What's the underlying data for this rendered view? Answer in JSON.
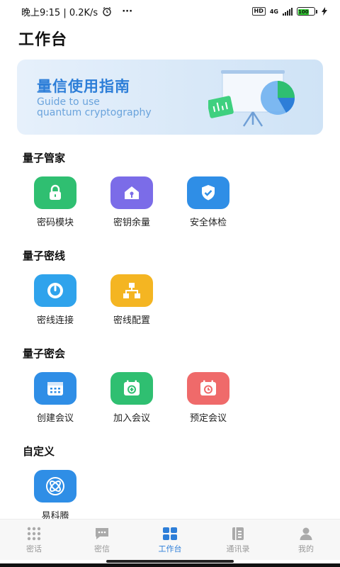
{
  "status_bar": {
    "time": "晚上9:15 | 0.2K/s",
    "more": "···",
    "network": "4G",
    "hd": "HD",
    "battery": "100"
  },
  "header": {
    "title": "工作台"
  },
  "banner": {
    "title": "量信使用指南",
    "subtitle": "Guide to use\nquantum cryptography"
  },
  "sections": [
    {
      "title": "量子管家",
      "items": [
        {
          "label": "密码模块",
          "icon": "lock-icon",
          "color": "#2fbf71"
        },
        {
          "label": "密钥余量",
          "icon": "key-house-icon",
          "color": "#7b6ce8"
        },
        {
          "label": "安全体检",
          "icon": "shield-check-icon",
          "color": "#2f8ee6"
        }
      ]
    },
    {
      "title": "量子密线",
      "items": [
        {
          "label": "密线连接",
          "icon": "connect-icon",
          "color": "#2fa3ec"
        },
        {
          "label": "密线配置",
          "icon": "network-icon",
          "color": "#f4b522"
        }
      ]
    },
    {
      "title": "量子密会",
      "items": [
        {
          "label": "创建会议",
          "icon": "calendar-icon",
          "color": "#2f8ee6"
        },
        {
          "label": "加入会议",
          "icon": "calendar-add-icon",
          "color": "#2fbf71"
        },
        {
          "label": "预定会议",
          "icon": "calendar-clock-icon",
          "color": "#ef6a6a"
        }
      ]
    },
    {
      "title": "自定义",
      "items": [
        {
          "label": "易科腾",
          "icon": "atom-icon",
          "color": "#2f8ee6"
        }
      ]
    }
  ],
  "bottom_nav": [
    {
      "label": "密话",
      "icon": "dialpad-icon",
      "active": false
    },
    {
      "label": "密信",
      "icon": "message-icon",
      "active": false
    },
    {
      "label": "工作台",
      "icon": "grid-icon",
      "active": true
    },
    {
      "label": "通讯录",
      "icon": "contacts-icon",
      "active": false
    },
    {
      "label": "我的",
      "icon": "person-icon",
      "active": false
    }
  ],
  "colors": {
    "accent": "#2d7ed8",
    "inactive": "#999999"
  }
}
